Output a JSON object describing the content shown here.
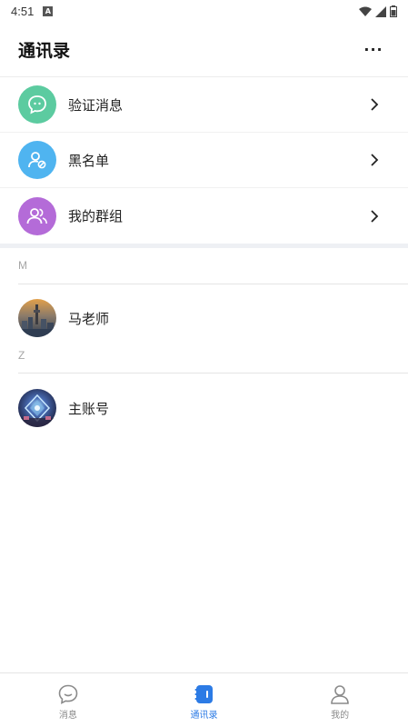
{
  "status_bar": {
    "time": "4:51",
    "notification_badge": "A"
  },
  "header": {
    "title": "通讯录",
    "more_label": "···"
  },
  "functions": [
    {
      "label": "验证消息",
      "icon": "chat-bubble-icon",
      "color": "#5ccba0"
    },
    {
      "label": "黑名单",
      "icon": "user-blocked-icon",
      "color": "#4fb4f0"
    },
    {
      "label": "我的群组",
      "icon": "group-icon",
      "color": "#b46bd8"
    }
  ],
  "groups": [
    {
      "letter": "M",
      "contacts": [
        {
          "name": "马老师"
        }
      ]
    },
    {
      "letter": "Z",
      "contacts": [
        {
          "name": "主账号"
        }
      ]
    }
  ],
  "bottom_nav": [
    {
      "label": "消息",
      "icon": "message-icon",
      "active": false
    },
    {
      "label": "通讯录",
      "icon": "contacts-icon",
      "active": true
    },
    {
      "label": "我的",
      "icon": "profile-icon",
      "active": false
    }
  ],
  "colors": {
    "accent": "#2c7be5",
    "divider": "#e5e5e5"
  }
}
